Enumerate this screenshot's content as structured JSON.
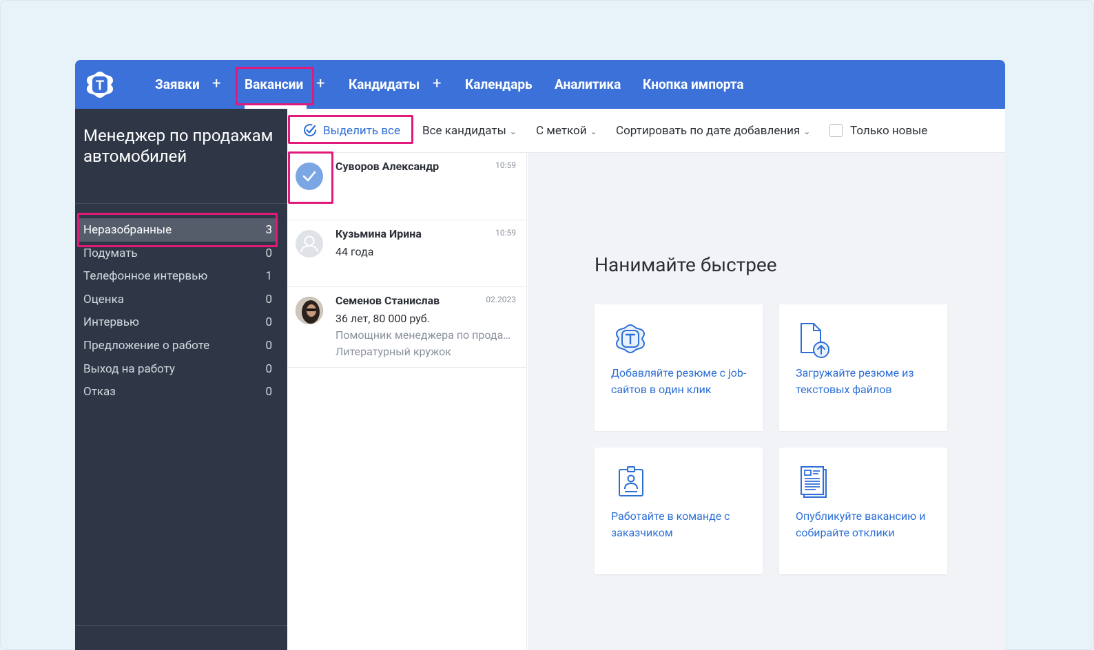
{
  "nav": {
    "items": [
      {
        "label": "Заявки"
      },
      {
        "label": "Вакансии"
      },
      {
        "label": "Кандидаты"
      },
      {
        "label": "Календарь"
      },
      {
        "label": "Аналитика"
      },
      {
        "label": "Кнопка импорта"
      }
    ],
    "plus": "+",
    "active": "Вакансии",
    "logo_letter": "T"
  },
  "vacancy": {
    "title": "Менеджер по продажам автомобилей",
    "stages": [
      {
        "label": "Неразобранные",
        "count": "3"
      },
      {
        "label": "Подумать",
        "count": "0"
      },
      {
        "label": "Телефонное интервью",
        "count": "1"
      },
      {
        "label": "Оценка",
        "count": "0"
      },
      {
        "label": "Интервью",
        "count": "0"
      },
      {
        "label": "Предложение о работе",
        "count": "0"
      },
      {
        "label": "Выход на работу",
        "count": "0"
      },
      {
        "label": "Отказ",
        "count": "0"
      }
    ]
  },
  "toolbar": {
    "select_all": "Выделить все",
    "all_candidates": "Все кандидаты",
    "with_tag": "С меткой",
    "sort": "Сортировать по дате добавления",
    "only_new": "Только новые"
  },
  "candidates": [
    {
      "name": "Суворов Александр",
      "time": "10:59",
      "lines": []
    },
    {
      "name": "Кузьмина Ирина",
      "time": "10:59",
      "lines": [
        "44 года"
      ]
    },
    {
      "name": "Семенов Станислав",
      "time": "02.2023",
      "lines": [
        "36 лет, 80 000 руб.",
        "Помощник менеджера по продажам",
        "Литературный кружок"
      ]
    }
  ],
  "main": {
    "title": "Нанимайте быстрее",
    "cards": [
      {
        "icon": "huntflow-logo-icon",
        "text": "Добавляйте резюме с job-сайтов в один клик"
      },
      {
        "icon": "file-upload-icon",
        "text": "Загружайте резюме из текстовых файлов"
      },
      {
        "icon": "badge-icon",
        "text": "Работайте в команде с заказчиком"
      },
      {
        "icon": "document-icon",
        "text": "Опубликуйте вакансию и собирайте отклики"
      }
    ]
  },
  "colors": {
    "topbar": "#3b71d8",
    "sidebar": "#2f3746",
    "highlight": "#e1197b",
    "link": "#2d6fd6"
  }
}
